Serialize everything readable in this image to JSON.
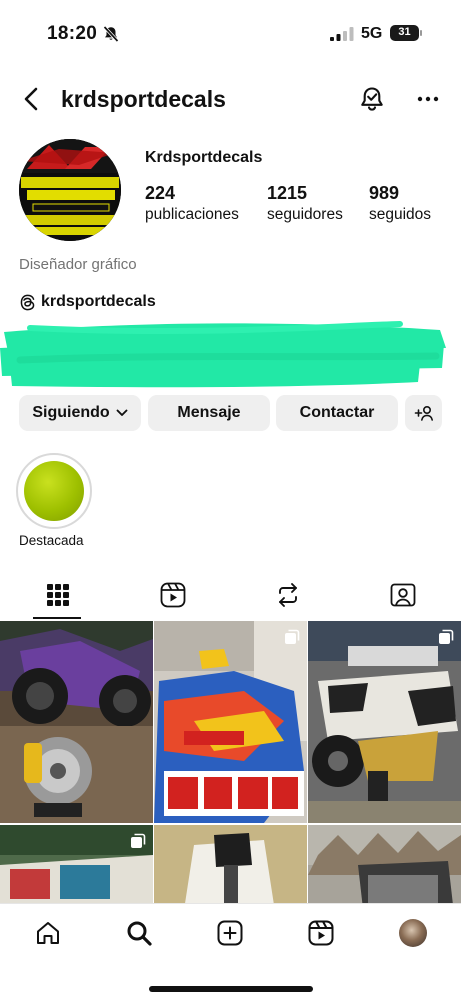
{
  "status_bar": {
    "time": "18:20",
    "network": "5G",
    "battery": "31"
  },
  "header": {
    "username": "krdsportdecals"
  },
  "profile": {
    "display_name": "Krdsportdecals",
    "category": "Diseñador gráfico",
    "threads_handle": "krdsportdecals",
    "stats": [
      {
        "value": "224",
        "label": "publicaciones"
      },
      {
        "value": "1215",
        "label": "seguidores"
      },
      {
        "value": "989",
        "label": "seguidos"
      }
    ]
  },
  "actions": {
    "following": "Siguiendo",
    "message": "Mensaje",
    "contact": "Contactar"
  },
  "highlights": [
    {
      "label": "Destacada"
    }
  ],
  "tabs": [
    "grid-icon",
    "reels-icon",
    "reposts-icon",
    "tagged-icon"
  ],
  "bottom_nav": [
    "home-icon",
    "search-icon",
    "create-icon",
    "reels-icon",
    "profile-avatar"
  ],
  "colors": {
    "redaction": "#22e8a6",
    "button_bg": "#efefef",
    "highlight": "#a8c800",
    "muted_text": "#737373"
  }
}
